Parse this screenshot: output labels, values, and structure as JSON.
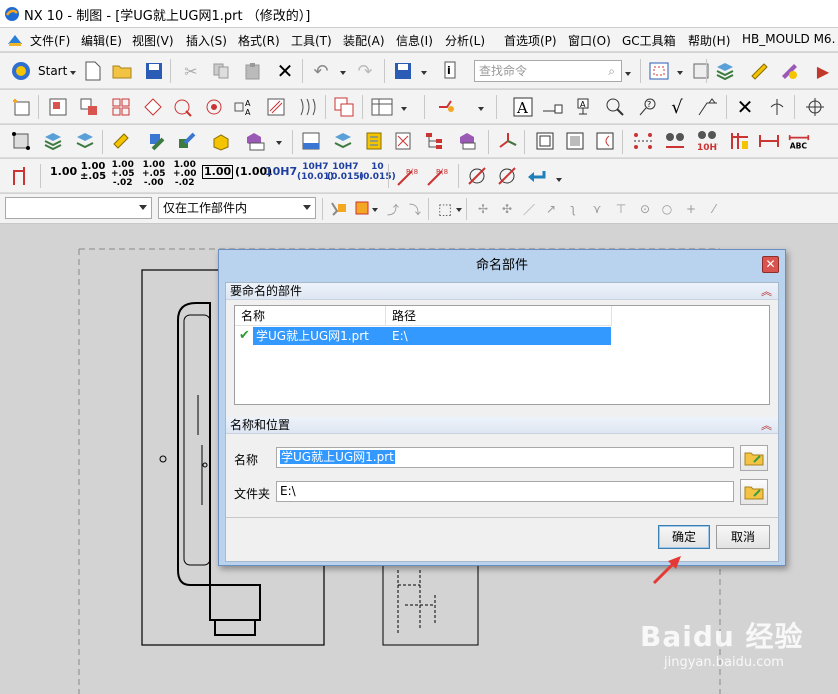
{
  "window": {
    "title": "NX 10 - 制图 - [学UG就上UG网1.prt （修改的）]"
  },
  "menu": [
    "文件(F)",
    "编辑(E)",
    "视图(V)",
    "插入(S)",
    "格式(R)",
    "工具(T)",
    "装配(A)",
    "信息(I)",
    "分析(L)",
    "首选项(P)",
    "窗口(O)",
    "GC工具箱",
    "帮助(H)",
    "HB_MOULD M6."
  ],
  "toolbar1": {
    "start_label": "Start",
    "search_placeholder": "查找命令"
  },
  "toolbar4": {
    "dims": [
      "1.00",
      "1.00\n±.05",
      "1.00\n+.05\n-.02",
      "1.00\n+.05\n-.00",
      "1.00\n+.00\n-.02",
      "1.00",
      "(1.00)",
      "10H7",
      "10H7\n(10.01)",
      "10H7\n(0.015)",
      "10\n(0.015)"
    ]
  },
  "selection_bar": {
    "filter_value": "",
    "scope_value": "仅在工作部件内"
  },
  "dialog": {
    "title": "命名部件",
    "section1_title": "要命名的部件",
    "col_name": "名称",
    "col_path": "路径",
    "row_name": "学UG就上UG网1.prt",
    "row_path": "E:\\",
    "section2_title": "名称和位置",
    "name_label": "名称",
    "name_value": "学UG就上UG网1.prt",
    "folder_label": "文件夹",
    "folder_value": "E:\\",
    "ok_label": "确定",
    "cancel_label": "取消"
  },
  "watermark": {
    "brand": "Baidu 经验",
    "url": "jingyan.baidu.com"
  },
  "colors": {
    "accent_select": "#3399ff",
    "dialog_frame": "#b9d3ee",
    "arrow_red": "#e53935"
  }
}
